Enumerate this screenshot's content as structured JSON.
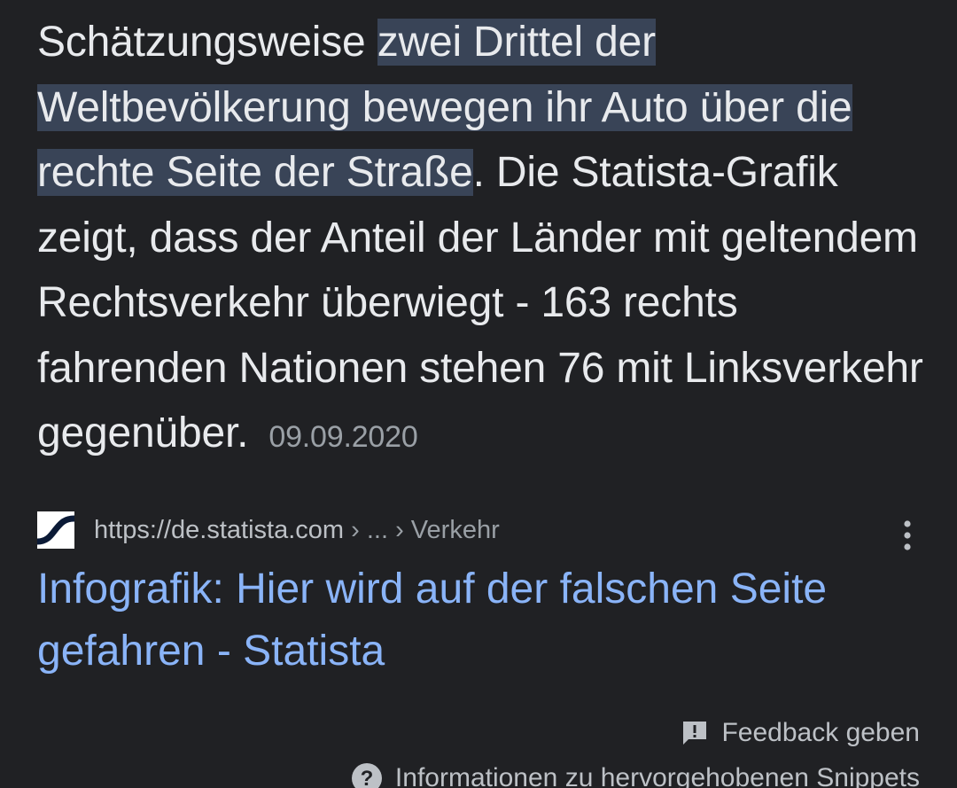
{
  "snippet": {
    "text_before": "Schätzungsweise ",
    "highlight": "zwei Drittel der Weltbevölkerung bewegen ihr Auto über die rechte Seite der Straße",
    "text_after": ". Die Statista-Grafik zeigt, dass der Anteil der Länder mit geltendem Rechtsverkehr überwiegt - 163 rechts fahrenden Nationen stehen 76 mit Linksverkehr gegenüber.",
    "date": "09.09.2020"
  },
  "source": {
    "favicon": "statista-logo-icon",
    "url": "https://de.statista.com",
    "breadcrumb": " › ... › Verkehr",
    "more_icon": "more-vert-icon"
  },
  "result": {
    "title": "Infografik: Hier wird auf der falschen Seite gefahren - Statista"
  },
  "footer": {
    "feedback_label": "Feedback geben",
    "feedback_icon": "feedback-icon",
    "info_label": "Informationen zu hervorgehobenen Snippets",
    "info_icon": "help-icon"
  },
  "colors": {
    "background": "#202124",
    "highlight": "#394457",
    "link": "#8ab4f8",
    "text": "#e8eaed",
    "muted": "#9aa0a6"
  }
}
